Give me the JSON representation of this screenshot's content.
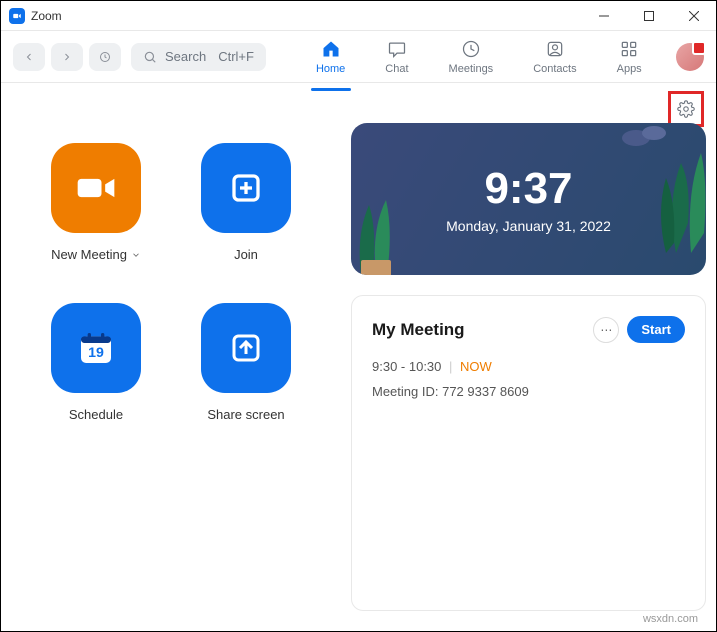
{
  "window": {
    "title": "Zoom"
  },
  "toolbar": {
    "search_label": "Search",
    "search_shortcut": "Ctrl+F"
  },
  "tabs": {
    "home": "Home",
    "chat": "Chat",
    "meetings": "Meetings",
    "contacts": "Contacts",
    "apps": "Apps"
  },
  "actions": {
    "new_meeting": "New Meeting",
    "join": "Join",
    "schedule": "Schedule",
    "schedule_day": "19",
    "share_screen": "Share screen"
  },
  "clock": {
    "time": "9:37",
    "date": "Monday, January 31, 2022"
  },
  "meeting": {
    "title": "My Meeting",
    "time_range": "9:30 - 10:30",
    "now_label": "NOW",
    "id_label": "Meeting ID: 772 9337 8609",
    "start_label": "Start"
  },
  "watermark": "wsxdn.com"
}
